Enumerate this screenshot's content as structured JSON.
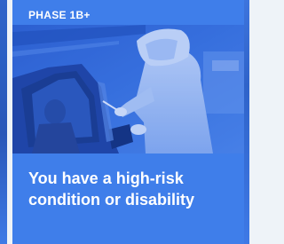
{
  "card": {
    "phase_label": "PHASE 1B+",
    "headline": "You have a high-risk condition or disability"
  },
  "image": {
    "subject": "drive-through-testing-photo"
  },
  "colors": {
    "card_background": "#3f7eea",
    "photo_tint": "#2e64d8",
    "text": "#ffffff"
  }
}
